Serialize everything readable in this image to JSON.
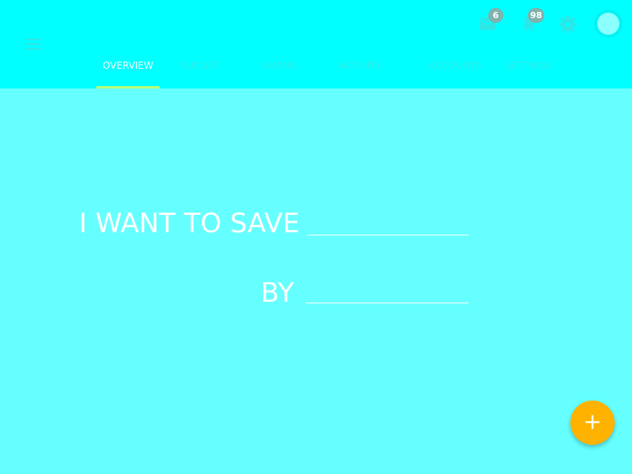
{
  "header": {
    "mail_badge": "6",
    "bookmark_badge": "98"
  },
  "tabs": [
    {
      "label": "OVERVIEW",
      "active": true
    },
    {
      "label": "BUDGET",
      "active": false
    },
    {
      "label": "SAVING",
      "active": false
    },
    {
      "label": "ACTIVITY",
      "active": false
    },
    {
      "label": "ACCOUNTS",
      "active": false
    },
    {
      "label": "SETTINGS",
      "active": false
    }
  ],
  "goal_form": {
    "save_label": "I WANT TO SAVE",
    "amount_value": "",
    "by_label": "BY",
    "date_value": ""
  },
  "fab": {
    "label": "+"
  },
  "icons": {
    "menu": "hamburger-menu-icon",
    "mail": "mail-icon",
    "bookmark": "bookmark-icon",
    "settings": "gear-icon",
    "add": "plus-icon"
  },
  "colors": {
    "appbar": "#00ffff",
    "background": "#66ffff",
    "tab_indicator": "#b7ff7a",
    "badge": "#7fb2ad",
    "fab": "#ffb300",
    "text": "#ffffff"
  }
}
